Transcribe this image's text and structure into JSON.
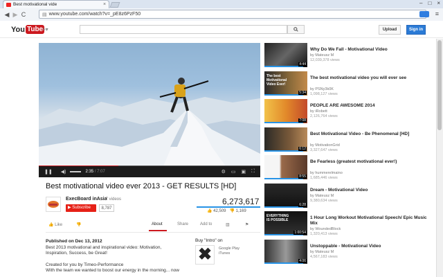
{
  "browser": {
    "tab_title": "Best motivational vide",
    "tab_close": "×",
    "url": "www.youtube.com/watch?v=_pE8z6PzF50",
    "back": "◀",
    "forward": "▶",
    "reload": "C",
    "win_min": "–",
    "win_max": "□",
    "win_close": "×"
  },
  "header": {
    "logo_you": "You",
    "logo_tube": "Tube",
    "search_placeholder": "",
    "upload_label": "Upload",
    "signin_label": "Sign in"
  },
  "player": {
    "current_time": "2:35",
    "duration": "7:07",
    "progress_fraction": 0.36
  },
  "video": {
    "title": "Best motivational video ever 2013 - GET RESULTS [HD]",
    "channel": "ExecBoard inAsia",
    "channel_videos": "· 7 videos",
    "subscribe_label": "Subscribe",
    "subscribers": "8,787",
    "views": "6,273,617",
    "likes": "42,509",
    "dislikes": "1,169",
    "like_label": "Like",
    "tabs": [
      "About",
      "Share",
      "Add to"
    ]
  },
  "description": {
    "published": "Published on Dec 13, 2012",
    "lines": [
      "Best 2013 motivational and inspirational video: Motivation,",
      "Inspiration, Success, be Great!",
      "",
      "Created for you by Timeo-Performance",
      "With the team we wanted to boost our energy in the morning... now"
    ]
  },
  "intro": {
    "heading": "Buy \"Intro\" on",
    "store1": "Google Play",
    "store2": "iTunes"
  },
  "related": [
    {
      "title": "Why Do We Fall - Motivational Video",
      "by": "by Mateusz M",
      "views": "12,039,378 views",
      "duration": "4:44",
      "watched": 0.9
    },
    {
      "title": "The best motivational video you will ever see",
      "by": "by PSNy3k0K",
      "views": "1,098,127 views",
      "duration": "5:34",
      "watched": 0.9
    },
    {
      "title": "PEOPLE ARE AWESOME 2014",
      "by": "by iRobett",
      "views": "2,126,764 views",
      "duration": "7:08",
      "watched": 0.9
    },
    {
      "title": "Best Motivational Video - Be Phenomenal [HD]",
      "by": "by MotivationGrid",
      "views": "3,327,647 views",
      "duration": "6:12",
      "watched": 0.9
    },
    {
      "title": "Be Fearless (greatest motivational ever!)",
      "by": "by hummerelmaino",
      "views": "1,685,446 views",
      "duration": "8:55",
      "watched": 0.9
    },
    {
      "title": "Dream - Motivational Video",
      "by": "by Mateusz M",
      "views": "9,380,634 views",
      "duration": "6:28",
      "watched": 0.9
    },
    {
      "title": "1 Hour Long Workout Motivational Speech/ Epic Music Mix",
      "by": "by WoundedBlock",
      "views": "1,320,413 views",
      "duration": "1:00:54",
      "watched": 0.9
    },
    {
      "title": "Unstoppable - Motivational Video",
      "by": "by Mateusz M",
      "views": "4,567,183 views",
      "duration": "4:06",
      "watched": 0.9
    }
  ],
  "thumb_text": {
    "t2": "The best\nMotivational\nVideo Ever!",
    "t7": "EVERYTHING\nIS POSSIBLE"
  },
  "colors": {
    "youtube_red": "#cc181e",
    "signin_blue": "#2b7bd6",
    "subscribe_red": "#e62117",
    "watched_blue": "#2793e6"
  }
}
